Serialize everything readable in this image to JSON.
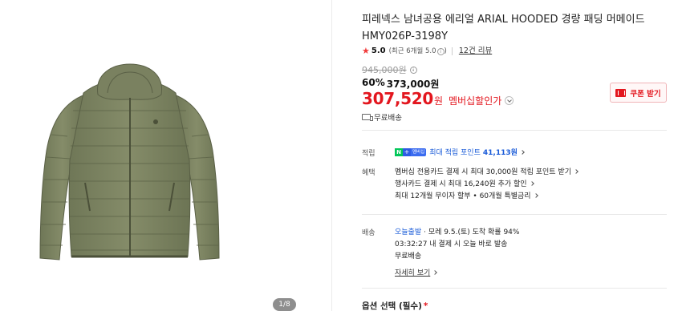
{
  "gallery": {
    "page_indicator": "1/8"
  },
  "product": {
    "title": "피레넥스 남녀공용 에리얼 ARIAL HOODED 경량 패딩 머메이드 HMY026P-3198Y",
    "rating_score": "5.0",
    "rating_sub": "(최근 6개월 5.0",
    "info_glyph": "i",
    "rating_sub_close": ")",
    "review_link": "12건 리뷰",
    "original_price": "945,000원",
    "discount_rate": "60%",
    "sale_price": "373,000원",
    "member_price": "307,520",
    "member_won": "원",
    "member_label": "멤버십할인가",
    "coupon_label": "쿠폰 받기",
    "free_shipping": "무료배송"
  },
  "benefits": {
    "points_label": "적립",
    "npay_n": "N",
    "npay_plus": "+",
    "npay_tag": "멤버십",
    "points_text": "최대 적립 포인트",
    "points_value": "41,113원",
    "perks_label": "혜택",
    "perks": [
      "멤버십 전용카드 결제 시 최대 30,000원 적립 포인트 받기",
      "행사카드 결제 시 최대 16,240원 추가 할인",
      "최대 12개월 무이자 할부 • 60개월 특별금리"
    ]
  },
  "shipping": {
    "label": "배송",
    "tag": "오늘출발",
    "eta": "· 모레 9.5.(토) 도착 확률 94%",
    "countdown": "03:32:27  내 결제 시 오늘 바로 발송",
    "fee": "무료배송",
    "detail_link": "자세히 보기"
  },
  "options": {
    "label": "옵션 선택 (필수)",
    "required_mark": "*"
  },
  "colors": {
    "accent_red": "#e3161e",
    "link_blue": "#1a5bd8",
    "jacket_olive": "#7b8260"
  }
}
